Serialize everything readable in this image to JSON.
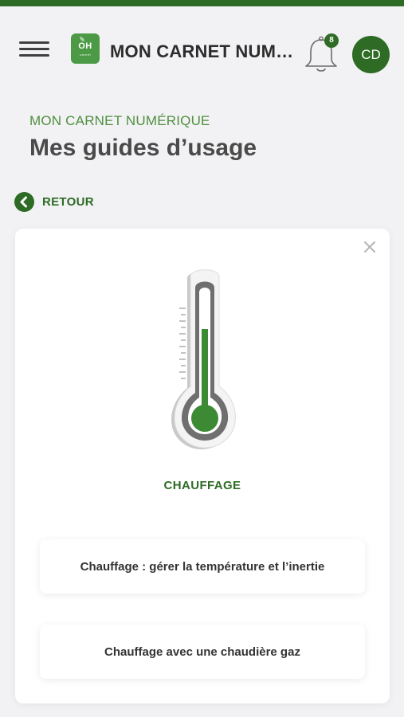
{
  "header": {
    "logo_text": "OH",
    "logo_subtext": "carnet",
    "app_title": "MON CARNET NUMÉRIQUE",
    "notifications_count": "8",
    "avatar_initials": "CD",
    "accent_color": "#2e6b25"
  },
  "page": {
    "breadcrumb": "MON CARNET NUMÉRIQUE",
    "title": "Mes guides d’usage",
    "back_label": "RETOUR"
  },
  "card": {
    "category": "CHAUFFAGE",
    "illustration": "thermometer-icon",
    "guides": [
      {
        "label": "Chauffage : gérer la température et l’inertie"
      },
      {
        "label": "Chauffage avec une chaudière gaz"
      }
    ]
  },
  "icons": {
    "menu": "hamburger-menu-icon",
    "bell": "bell-icon",
    "back": "chevron-left-icon",
    "close": "close-icon"
  }
}
